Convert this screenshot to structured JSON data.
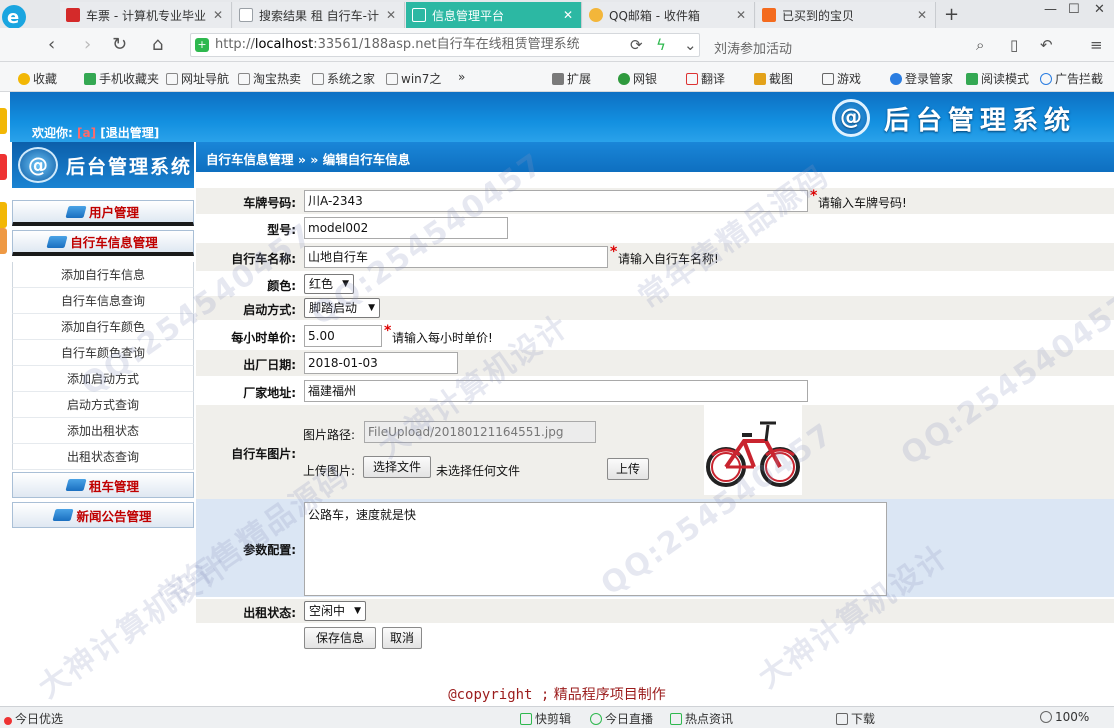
{
  "browser": {
    "tabs": [
      {
        "title": "车票 - 计算机专业毕业",
        "icon": "red-flag-icon",
        "color": "#d42a2a"
      },
      {
        "title": "搜索结果 租 自行车-计",
        "icon": "page-icon",
        "color": "#9aa0a6"
      },
      {
        "title": "信息管理平台",
        "icon": "page-icon",
        "color": "#ffffff"
      },
      {
        "title": "QQ邮箱 - 收件箱",
        "icon": "qq-mail-icon",
        "color": "#f3b63a"
      },
      {
        "title": "已买到的宝贝",
        "icon": "taobao-icon",
        "color": "#f46b1e"
      }
    ],
    "url_prefix": "http://",
    "url_host": "localhost",
    "url_rest": ":33561/188asp.net自行车在线租赁管理系统",
    "search_text": "刘涛参加活动",
    "bookmarks": {
      "collect": "收藏",
      "mobile": "手机收藏夹",
      "nav": "网址导航",
      "taobao": "淘宝热卖",
      "xitong": "系统之家",
      "win7": "win7之",
      "more": "»",
      "ext": "扩展",
      "bank": "网银",
      "translate": "翻译",
      "screenshot": "截图",
      "game": "游戏",
      "login": "登录管家",
      "read": "阅读模式",
      "adblock": "广告拦截"
    }
  },
  "admin": {
    "welcome_prefix": "欢迎你:",
    "welcome_user": "[a]",
    "logout": "[退出管理]",
    "brand_title": "后台管理系统",
    "left_brand": "后台管理系统",
    "breadcrumb": "自行车信息管理 » » 编辑自行车信息",
    "menu": {
      "user": "用户管理",
      "bike": "自行车信息管理",
      "rent": "租车管理",
      "news": "新闻公告管理",
      "items": [
        "添加自行车信息",
        "自行车信息查询",
        "添加自行车颜色",
        "自行车颜色查询",
        "添加启动方式",
        "启动方式查询",
        "添加出租状态",
        "出租状态查询"
      ]
    },
    "form": {
      "plate_label": "车牌号码:",
      "plate_value": "川A-2343",
      "plate_hint": "请输入车牌号码!",
      "model_label": "型号:",
      "model_value": "model002",
      "name_label": "自行车名称:",
      "name_value": "山地自行车",
      "name_hint": "请输入自行车名称!",
      "color_label": "颜色:",
      "color_value": "红色",
      "start_label": "启动方式:",
      "start_value": "脚踏启动",
      "price_label": "每小时单价:",
      "price_value": "5.00",
      "price_hint": "请输入每小时单价!",
      "date_label": "出厂日期:",
      "date_value": "2018-01-03",
      "addr_label": "厂家地址:",
      "addr_value": "福建福州",
      "img_label": "自行车图片:",
      "img_path_label": "图片路径:",
      "img_path_value": "FileUpload/20180121164551.jpg",
      "upload_label": "上传图片:",
      "choose_btn": "选择文件",
      "no_file": "未选择任何文件",
      "upload_btn": "上传",
      "param_label": "参数配置:",
      "param_value": "公路车，速度就是快",
      "status_label": "出租状态:",
      "status_value": "空闲中",
      "save_btn": "保存信息",
      "cancel_btn": "取消"
    },
    "copyright_a": "@copyright ;",
    "copyright_b": "精品程序项目制作",
    "watermarks": [
      "大神计算机设计",
      "常年售精品源码",
      "QQ:254540457"
    ]
  },
  "statusbar": {
    "left": "今日优选",
    "kuai": "快剪辑",
    "live": "今日直播",
    "hot": "热点资讯",
    "down": "下载",
    "zoom": "100%"
  },
  "colors": {
    "accent_tab": "#2cb8a3",
    "header_blue": "#1390e0",
    "menu_red": "#c00000",
    "copyright": "#9b1c1c"
  }
}
